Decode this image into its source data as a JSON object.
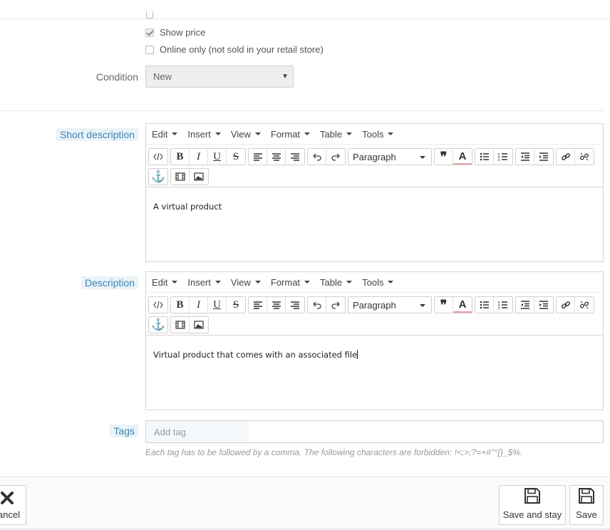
{
  "options": {
    "show_price_label": "Show price",
    "show_price_checked": true,
    "online_only_label": "Online only (not sold in your retail store)",
    "online_only_checked": false
  },
  "condition": {
    "label": "Condition",
    "selected": "New"
  },
  "short_description": {
    "label": "Short description",
    "menus": [
      "Edit",
      "Insert",
      "View",
      "Format",
      "Table",
      "Tools"
    ],
    "paragraph_format": "Paragraph",
    "content": "A virtual product"
  },
  "description": {
    "label": "Description",
    "menus": [
      "Edit",
      "Insert",
      "View",
      "Format",
      "Table",
      "Tools"
    ],
    "paragraph_format": "Paragraph",
    "content": "Virtual product that comes with an associated file"
  },
  "tags": {
    "label": "Tags",
    "placeholder": "Add tag",
    "help": "Each tag has to be followed by a comma. The following characters are forbidden: !<;>;?=+#\"°{}_$%."
  },
  "footer": {
    "cancel_label": "ancel",
    "save_and_stay_label": "Save and stay",
    "save_label": "Save"
  },
  "icons": {
    "editor_buttons": [
      "code-icon",
      "bold-icon",
      "italic-icon",
      "underline-icon",
      "strikethrough-icon",
      "align-left-icon",
      "align-center-icon",
      "align-right-icon",
      "undo-icon",
      "redo-icon",
      "blockquote-icon",
      "text-color-icon",
      "bullet-list-icon",
      "numbered-list-icon",
      "outdent-icon",
      "indent-icon",
      "link-icon",
      "unlink-icon",
      "anchor-icon",
      "media-icon",
      "image-icon"
    ],
    "footer": [
      "close-icon",
      "floppy-disk-icon"
    ]
  },
  "colors": {
    "label_highlight_bg": "#eaf3f8",
    "label_highlight_text": "#3f83b4"
  }
}
